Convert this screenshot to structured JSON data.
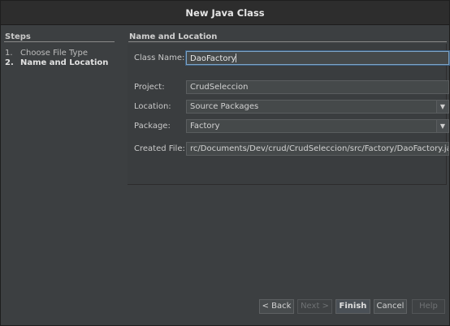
{
  "window": {
    "title": "New Java Class"
  },
  "steps": {
    "header": "Steps",
    "items": [
      {
        "number": "1.",
        "label": "Choose File Type",
        "current": false
      },
      {
        "number": "2.",
        "label": "Name and Location",
        "current": true
      }
    ]
  },
  "panel": {
    "header": "Name and Location",
    "class_name": {
      "label": "Class Name:",
      "value": "DaoFactory"
    },
    "project": {
      "label": "Project:",
      "value": "CrudSeleccion"
    },
    "location": {
      "label": "Location:",
      "value": "Source Packages"
    },
    "package": {
      "label": "Package:",
      "value": "Factory"
    },
    "created_file": {
      "label": "Created File:",
      "value": "rc/Documents/Dev/crud/CrudSeleccion/src/Factory/DaoFactory.java"
    }
  },
  "buttons": {
    "back": "< Back",
    "next": "Next >",
    "finish": "Finish",
    "cancel": "Cancel",
    "help": "Help"
  },
  "icons": {
    "dropdown": "chevron-down-icon"
  },
  "colors": {
    "background": "#3c3f41",
    "focus_border": "#7ea3c4"
  }
}
